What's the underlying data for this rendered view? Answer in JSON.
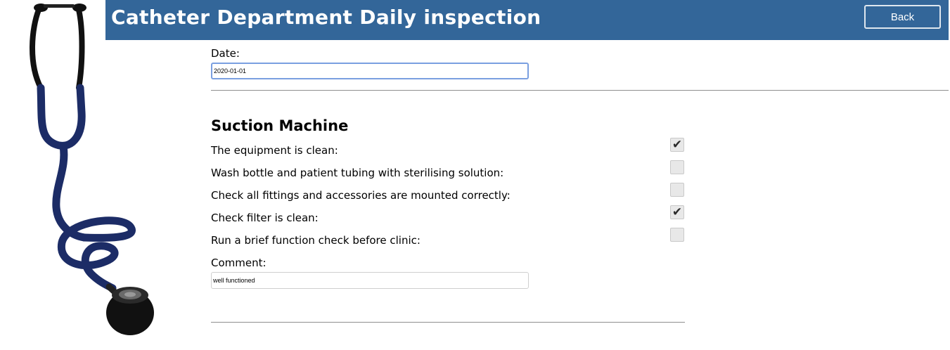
{
  "header": {
    "title": "Catheter Department Daily inspection",
    "back_label": "Back",
    "background_color": "#336699"
  },
  "date": {
    "label": "Date:",
    "value": "2020-01-01"
  },
  "section": {
    "title": "Suction Machine",
    "items": [
      {
        "label": "The equipment is clean:",
        "checked": true
      },
      {
        "label": "Wash bottle and patient tubing with sterilising solution:",
        "checked": false
      },
      {
        "label": "Check all fittings and accessories are mounted correctly:",
        "checked": false
      },
      {
        "label": "Check filter is clean:",
        "checked": true
      },
      {
        "label": "Run a brief function check before clinic:",
        "checked": false
      }
    ],
    "comment_label": "Comment:",
    "comment_value": "well functioned"
  },
  "icons": {
    "illustration": "stethoscope-illustration",
    "check": "checkmark-icon"
  }
}
